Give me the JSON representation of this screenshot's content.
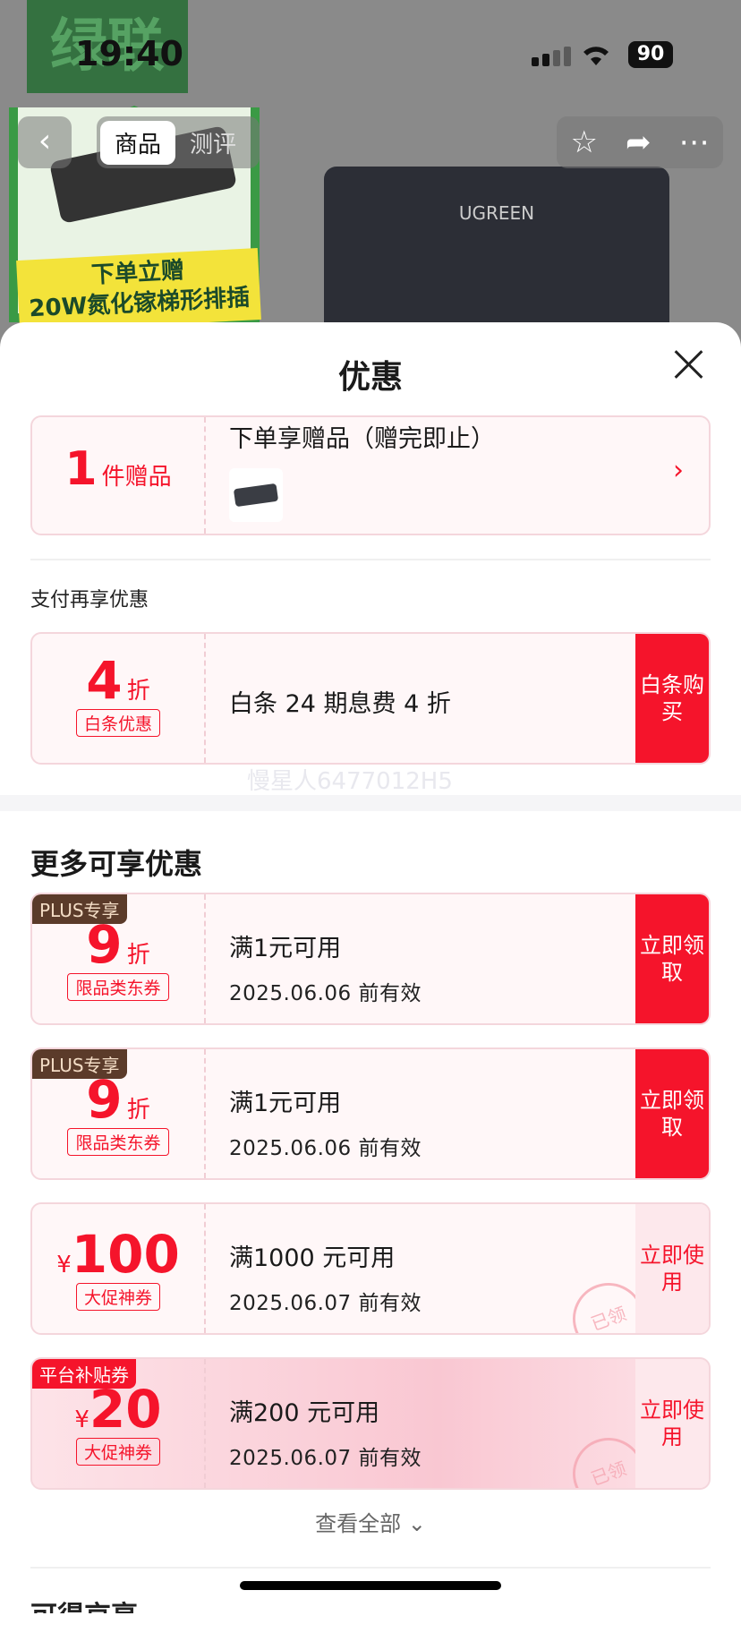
{
  "status": {
    "time": "19:40",
    "battery": "90"
  },
  "background": {
    "brand_text": "绿联",
    "tabs": [
      {
        "label": "商品"
      },
      {
        "label": "测评"
      }
    ],
    "promo_line1": "下单立赠",
    "promo_line2": "20W氮化镓梯形排插",
    "product_brand": "UGREEN",
    "icons": [
      "back-icon",
      "star-icon",
      "share-icon",
      "more-icon"
    ]
  },
  "sheet": {
    "title": "优惠",
    "gift": {
      "count": "1",
      "unit": "件赠品",
      "title": "下单享赠品（赠完即止）"
    },
    "pay_section": "支付再享优惠",
    "baitiao": {
      "value": "4",
      "unit": "折",
      "tag": "白条优惠",
      "desc": "白条 24 期息费 4 折",
      "action": "白条购买"
    },
    "watermark": "慢星人6477012H5",
    "more_section": "更多可享优惠",
    "coupons": [
      {
        "badge": "PLUS专享",
        "value": "9",
        "unit": "折",
        "tag": "限品类东券",
        "cond": "满1元可用",
        "valid": "2025.06.06 前有效",
        "action": "立即领取",
        "claimed": ""
      },
      {
        "badge": "PLUS专享",
        "value": "9",
        "unit": "折",
        "tag": "限品类东券",
        "cond": "满1元可用",
        "valid": "2025.06.06 前有效",
        "action": "立即领取",
        "claimed": ""
      },
      {
        "badge": "",
        "currency": "¥",
        "value": "100",
        "tag": "大促神券",
        "cond": "满1000 元可用",
        "valid": "2025.06.07 前有效",
        "action": "立即使用",
        "claimed": "已领"
      },
      {
        "badge": "平台补贴券",
        "currency": "¥",
        "value": "20",
        "tag": "大促神券",
        "cond": "满200 元可用",
        "valid": "2025.06.07 前有效",
        "action": "立即使用",
        "claimed": "已领"
      }
    ],
    "see_all": "查看全部",
    "peek_text": "可得京享"
  }
}
